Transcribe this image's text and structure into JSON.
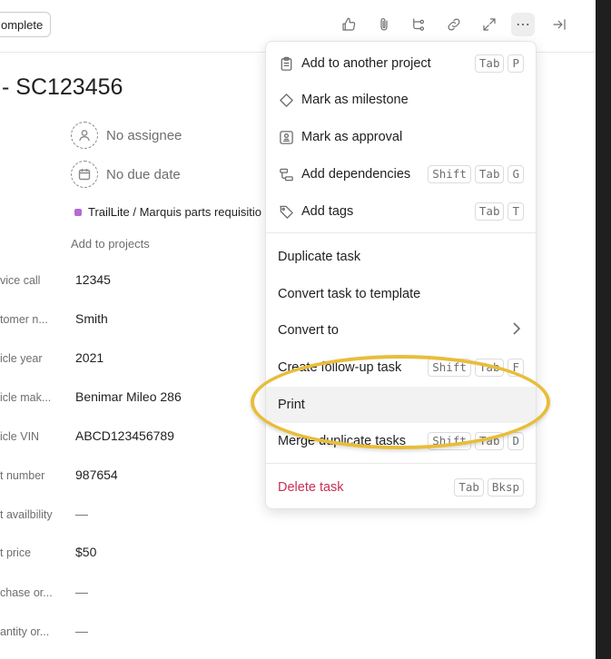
{
  "toolbar": {
    "complete_label": "omplete",
    "icons": [
      "thumbs-up-icon",
      "attachment-icon",
      "subtask-icon",
      "link-icon",
      "expand-icon",
      "more-icon",
      "close-panel-icon"
    ]
  },
  "task": {
    "title": "- SC123456",
    "assignee": "No assignee",
    "due_date": "No due date",
    "project": "TrailLite / Marquis parts requisitio",
    "add_projects": "Add to projects",
    "project_color": "#b36bd4"
  },
  "fields": [
    {
      "label": "vice call",
      "value": "12345"
    },
    {
      "label": "tomer n...",
      "value": "Smith"
    },
    {
      "label": "icle year",
      "value": "2021"
    },
    {
      "label": "icle mak...",
      "value": "Benimar Mileo 286"
    },
    {
      "label": "icle VIN",
      "value": "ABCD123456789"
    },
    {
      "label": "t number",
      "value": "987654"
    },
    {
      "label": "t availbility",
      "value": "—"
    },
    {
      "label": "t price",
      "value": "$50"
    },
    {
      "label": "chase or...",
      "value": "—"
    },
    {
      "label": "antity or...",
      "value": "—"
    }
  ],
  "menu": {
    "add_to_project": {
      "label": "Add to another project",
      "keys": [
        "Tab",
        "P"
      ]
    },
    "mark_milestone": {
      "label": "Mark as milestone"
    },
    "mark_approval": {
      "label": "Mark as approval"
    },
    "add_dependencies": {
      "label": "Add dependencies",
      "keys": [
        "Shift",
        "Tab",
        "G"
      ]
    },
    "add_tags": {
      "label": "Add tags",
      "keys": [
        "Tab",
        "T"
      ]
    },
    "duplicate_task": {
      "label": "Duplicate task"
    },
    "convert_template": {
      "label": "Convert task to template"
    },
    "convert_to": {
      "label": "Convert to"
    },
    "follow_up": {
      "label": "Create follow-up task",
      "keys": [
        "Shift",
        "Tab",
        "F"
      ]
    },
    "print": {
      "label": "Print"
    },
    "merge_duplicates": {
      "label": "Merge duplicate tasks",
      "keys": [
        "Shift",
        "Tab",
        "D"
      ]
    },
    "delete_task": {
      "label": "Delete task",
      "keys": [
        "Tab",
        "Bksp"
      ]
    }
  },
  "colors": {
    "danger": "#c92f54",
    "highlight": "#e8bd3a"
  }
}
